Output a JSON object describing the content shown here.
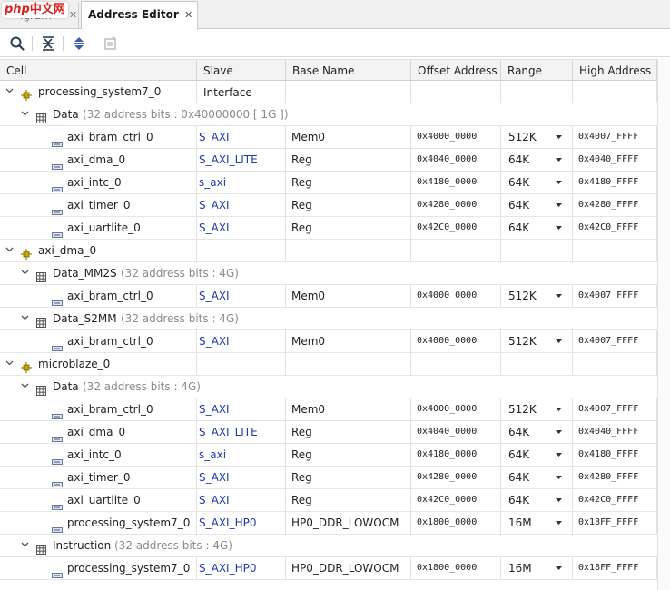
{
  "tabs": {
    "inactive_label": "igram",
    "active_label": "Address Editor",
    "close_glyph": "✕"
  },
  "logo": {
    "php": "php",
    "cn": "中文网"
  },
  "toolbar": {
    "icons": [
      "search-icon",
      "collapse-all-icon",
      "expand-all-icon",
      "auto-assign-icon"
    ]
  },
  "columns": {
    "cell": "Cell",
    "slave": "Slave Interface",
    "base": "Base Name",
    "offset": "Offset Address",
    "range": "Range",
    "high": "High Address"
  },
  "groups": {
    "ps7": {
      "name": "processing_system7_0",
      "spaces": {
        "data": {
          "name": "Data",
          "info": "(32 address bits : 0x40000000 [ 1G ])",
          "rows": [
            {
              "cell": "axi_bram_ctrl_0",
              "slave": "S_AXI",
              "base": "Mem0",
              "offset": "0x4000_0000",
              "range": "512K",
              "high": "0x4007_FFFF"
            },
            {
              "cell": "axi_dma_0",
              "slave": "S_AXI_LITE",
              "base": "Reg",
              "offset": "0x4040_0000",
              "range": "64K",
              "high": "0x4040_FFFF"
            },
            {
              "cell": "axi_intc_0",
              "slave": "s_axi",
              "base": "Reg",
              "offset": "0x4180_0000",
              "range": "64K",
              "high": "0x4180_FFFF"
            },
            {
              "cell": "axi_timer_0",
              "slave": "S_AXI",
              "base": "Reg",
              "offset": "0x4280_0000",
              "range": "64K",
              "high": "0x4280_FFFF"
            },
            {
              "cell": "axi_uartlite_0",
              "slave": "S_AXI",
              "base": "Reg",
              "offset": "0x42C0_0000",
              "range": "64K",
              "high": "0x42C0_FFFF"
            }
          ]
        }
      }
    },
    "dma": {
      "name": "axi_dma_0",
      "spaces": {
        "mm2s": {
          "name": "Data_MM2S",
          "info": "(32 address bits : 4G)",
          "rows": [
            {
              "cell": "axi_bram_ctrl_0",
              "slave": "S_AXI",
              "base": "Mem0",
              "offset": "0x4000_0000",
              "range": "512K",
              "high": "0x4007_FFFF"
            }
          ]
        },
        "s2mm": {
          "name": "Data_S2MM",
          "info": "(32 address bits : 4G)",
          "rows": [
            {
              "cell": "axi_bram_ctrl_0",
              "slave": "S_AXI",
              "base": "Mem0",
              "offset": "0x4000_0000",
              "range": "512K",
              "high": "0x4007_FFFF"
            }
          ]
        }
      }
    },
    "mb": {
      "name": "microblaze_0",
      "spaces": {
        "data": {
          "name": "Data",
          "info": "(32 address bits : 4G)",
          "rows": [
            {
              "cell": "axi_bram_ctrl_0",
              "slave": "S_AXI",
              "base": "Mem0",
              "offset": "0x4000_0000",
              "range": "512K",
              "high": "0x4007_FFFF"
            },
            {
              "cell": "axi_dma_0",
              "slave": "S_AXI_LITE",
              "base": "Reg",
              "offset": "0x4040_0000",
              "range": "64K",
              "high": "0x4040_FFFF"
            },
            {
              "cell": "axi_intc_0",
              "slave": "s_axi",
              "base": "Reg",
              "offset": "0x4180_0000",
              "range": "64K",
              "high": "0x4180_FFFF"
            },
            {
              "cell": "axi_timer_0",
              "slave": "S_AXI",
              "base": "Reg",
              "offset": "0x4280_0000",
              "range": "64K",
              "high": "0x4280_FFFF"
            },
            {
              "cell": "axi_uartlite_0",
              "slave": "S_AXI",
              "base": "Reg",
              "offset": "0x42C0_0000",
              "range": "64K",
              "high": "0x42C0_FFFF"
            },
            {
              "cell": "processing_system7_0",
              "slave": "S_AXI_HP0",
              "base": "HP0_DDR_LOWOCM",
              "offset": "0x1800_0000",
              "range": "16M",
              "high": "0x18FF_FFFF"
            }
          ]
        },
        "instruction": {
          "name": "Instruction",
          "info": "(32 address bits : 4G)",
          "rows": [
            {
              "cell": "processing_system7_0",
              "slave": "S_AXI_HP0",
              "base": "HP0_DDR_LOWOCM",
              "offset": "0x1800_0000",
              "range": "16M",
              "high": "0x18FF_FFFF"
            }
          ]
        }
      }
    }
  },
  "colors": {
    "slave_link": "#1f3aa6",
    "dim_text": "#8a8a8a",
    "master_icon": "#c8a400",
    "logo_red": "#d8231f"
  }
}
